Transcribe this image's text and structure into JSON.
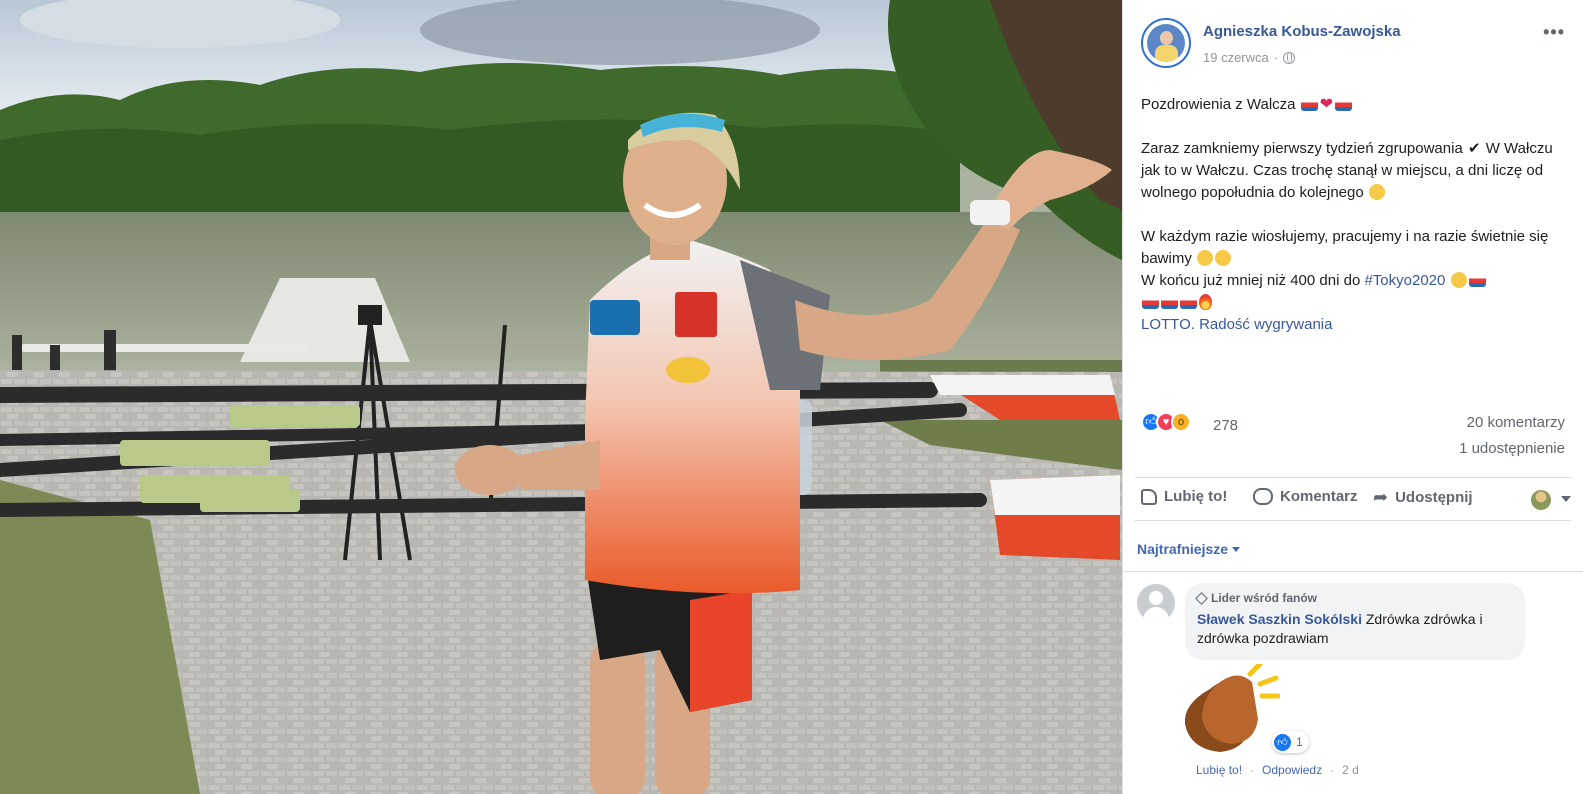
{
  "post": {
    "author": "Agnieszka Kobus-Zawojska",
    "date": "19 czerwca",
    "separator": "·",
    "more_label": "•••",
    "text": {
      "l1": "Pozdrowienia z Walcza",
      "l2": "Zaraz zamkniemy pierwszy tydzień zgrupowania",
      "l3": "W Wałczu jak to w Wałczu. Czas trochę stanął w miejscu, a dni liczę od wolnego popołudnia do kolejnego",
      "l4": "W każdym razie wiosłujemy, pracujemy i na razie świetnie się bawimy",
      "l5": "W końcu już mniej niż 400 dni do",
      "hashtag": "#Tokyo2020",
      "link": "LOTTO. Radość wygrywania"
    }
  },
  "reactions": {
    "count": "278",
    "types": [
      "like-icon",
      "love-icon",
      "wow-icon"
    ],
    "comments": "20 komentarzy",
    "shares": "1 udostępnienie"
  },
  "actions": {
    "like": "Lubię to!",
    "comment": "Komentarz",
    "share": "Udostępnij"
  },
  "sort_label": "Najtrafniejsze",
  "comment": {
    "badge": "Lider wśród fanów",
    "name": "Sławek Saszkin Sokólski",
    "text": "Zdrówka zdrówka i zdrówka pozdrawiam",
    "sticker": "clapping-hands-icon",
    "likes": "1",
    "like_label": "Lubię to!",
    "reply_label": "Odpowiedz",
    "dot": "·",
    "time": "2 d"
  },
  "colors": {
    "link": "#385898",
    "like_blue": "#1877f2",
    "love_red": "#f33e58",
    "wow_yellow": "#f7b125",
    "meta_gray": "#90949c"
  }
}
